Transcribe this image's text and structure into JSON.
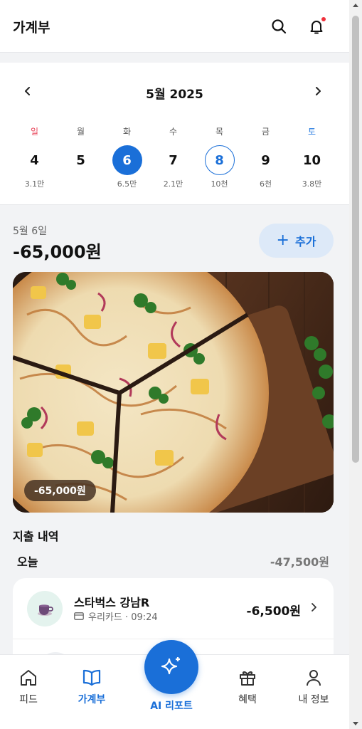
{
  "header": {
    "title": "가계부",
    "has_notification": true
  },
  "calendar": {
    "month_label": "5월 2025",
    "days": [
      {
        "dow": "일",
        "date": "4",
        "amount": "3.1만",
        "kind": "sun",
        "state": ""
      },
      {
        "dow": "월",
        "date": "5",
        "amount": "",
        "kind": "",
        "state": ""
      },
      {
        "dow": "화",
        "date": "6",
        "amount": "6.5만",
        "kind": "",
        "state": "selected"
      },
      {
        "dow": "수",
        "date": "7",
        "amount": "2.1만",
        "kind": "",
        "state": ""
      },
      {
        "dow": "목",
        "date": "8",
        "amount": "10천",
        "kind": "",
        "state": "today"
      },
      {
        "dow": "금",
        "date": "9",
        "amount": "6천",
        "kind": "",
        "state": ""
      },
      {
        "dow": "토",
        "date": "10",
        "amount": "3.8만",
        "kind": "sat",
        "state": ""
      }
    ]
  },
  "summary": {
    "date_label": "5월 6일",
    "total": "-65,000원",
    "add_label": "추가"
  },
  "photo": {
    "badge": "-65,000원"
  },
  "expenses": {
    "section_title": "지출 내역",
    "group_label": "오늘",
    "group_total": "-47,500원",
    "items": [
      {
        "name": "스타벅스 강남R",
        "meta": "우리카드 · 09:24",
        "amount": "-6,500원",
        "icon": "coffee-icon"
      }
    ]
  },
  "nav": {
    "feed": "피드",
    "ledger": "가계부",
    "ai_report": "AI 리포트",
    "benefits": "혜택",
    "my_info": "내 정보",
    "active": "ledger"
  },
  "colors": {
    "primary": "#1a6fd8",
    "sunday": "#e8455a",
    "saturday": "#2a7de1",
    "notification": "#f0313c"
  }
}
